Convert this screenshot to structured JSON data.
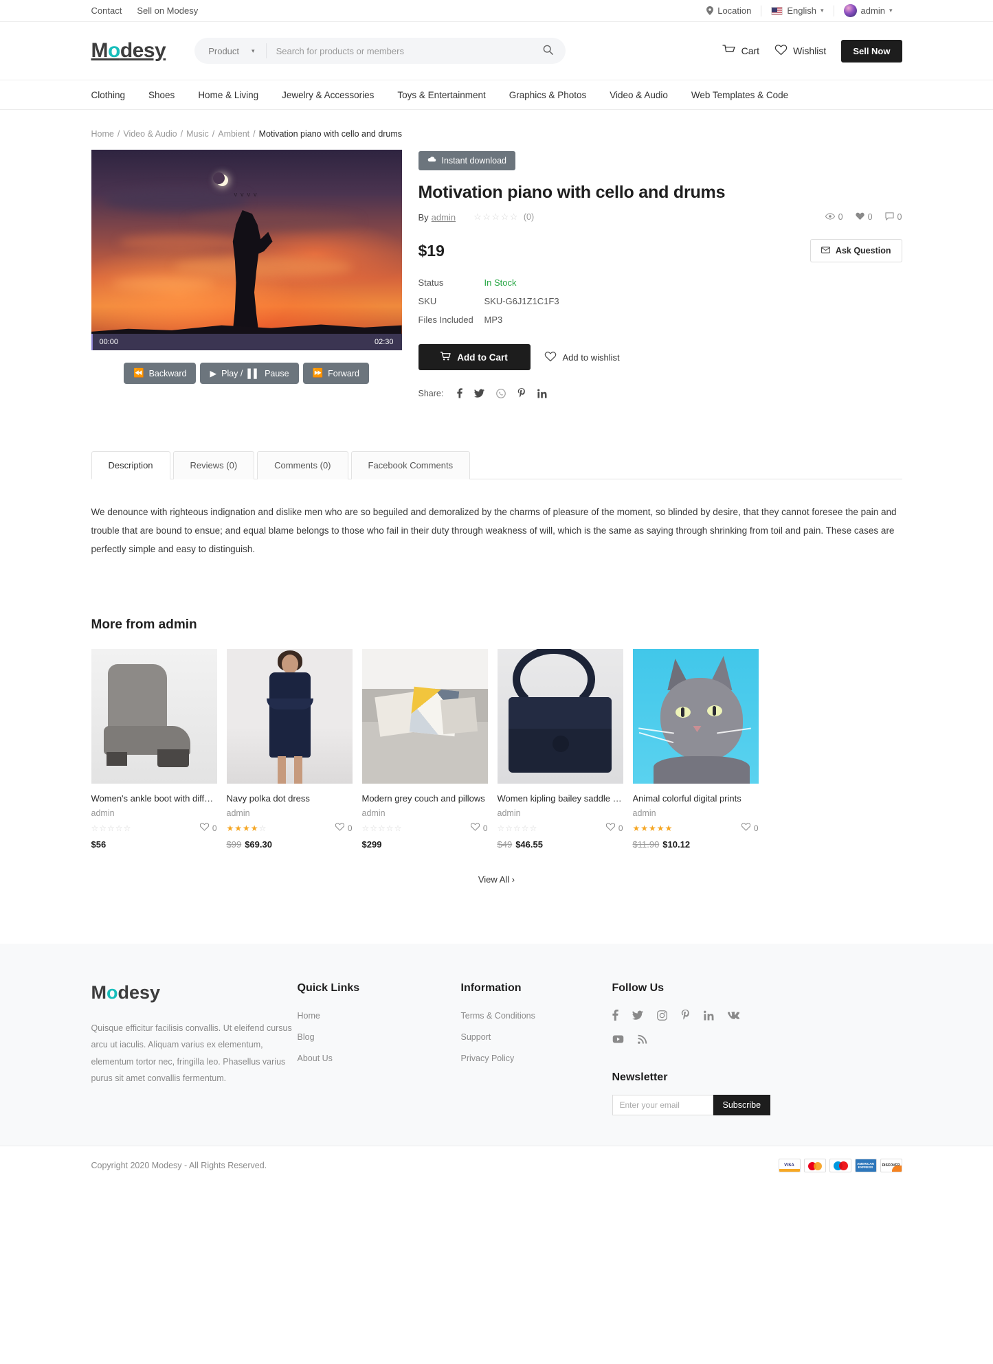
{
  "topbar": {
    "left_links": [
      "Contact",
      "Sell on Modesy"
    ],
    "location": "Location",
    "language": "English",
    "user": "admin"
  },
  "header": {
    "logo_first": "M",
    "logo_accent": "o",
    "logo_rest": "desy",
    "search_category": "Product",
    "search_placeholder": "Search for products or members",
    "cart_label": "Cart",
    "wishlist_label": "Wishlist",
    "sell_now_label": "Sell Now"
  },
  "nav": {
    "items": [
      "Clothing",
      "Shoes",
      "Home & Living",
      "Jewelry & Accessories",
      "Toys & Entertainment",
      "Graphics & Photos",
      "Video & Audio",
      "Web Templates & Code"
    ]
  },
  "breadcrumb": {
    "items": [
      "Home",
      "Video & Audio",
      "Music",
      "Ambient"
    ],
    "current": "Motivation piano with cello and drums"
  },
  "player": {
    "current_time": "00:00",
    "duration": "02:30",
    "backward_label": "Backward",
    "play_pause_label": "Play /",
    "pause_label": "Pause",
    "forward_label": "Forward"
  },
  "product": {
    "badge": "Instant download",
    "title": "Motivation piano with cello and drums",
    "by_label": "By",
    "author": "admin",
    "rating": 0,
    "rating_count": "(0)",
    "views": "0",
    "likes": "0",
    "comments": "0",
    "price": "$19",
    "ask_question_label": "Ask Question",
    "specs": [
      {
        "label": "Status",
        "value": "In Stock",
        "highlight": "#28a745"
      },
      {
        "label": "SKU",
        "value": "SKU-G6J1Z1C1F3",
        "highlight": ""
      },
      {
        "label": "Files Included",
        "value": "MP3",
        "highlight": ""
      }
    ],
    "add_to_cart_label": "Add to Cart",
    "add_to_wishlist_label": "Add to wishlist",
    "share_label": "Share:",
    "share_icons": [
      "facebook-icon",
      "twitter-icon",
      "whatsapp-icon",
      "pinterest-icon",
      "linkedin-icon"
    ]
  },
  "tabs": {
    "items": [
      "Description",
      "Reviews (0)",
      "Comments (0)",
      "Facebook Comments"
    ],
    "active_index": 0,
    "description": "We denounce with righteous indignation and dislike men who are so beguiled and demoralized by the charms of pleasure of the moment, so blinded by desire, that they cannot foresee the pain and trouble that are bound to ensue; and equal blame belongs to those who fail in their duty through weakness of will, which is the same as saying through shrinking from toil and pain. These cases are perfectly simple and easy to distinguish."
  },
  "more_from": {
    "title": "More from admin",
    "view_all": "View All",
    "products": [
      {
        "title": "Women's ankle boot with differen...",
        "author": "admin",
        "rating": 0,
        "likes": "0",
        "price": "$56",
        "old_price": "",
        "art": "art-boot"
      },
      {
        "title": "Navy polka dot dress",
        "author": "admin",
        "rating": 4,
        "likes": "0",
        "price": "$69.30",
        "old_price": "$99",
        "art": "art-dress"
      },
      {
        "title": "Modern grey couch and pillows",
        "author": "admin",
        "rating": 0,
        "likes": "0",
        "price": "$299",
        "old_price": "",
        "art": "art-couch"
      },
      {
        "title": "Women kipling bailey saddle han...",
        "author": "admin",
        "rating": 0,
        "likes": "0",
        "price": "$46.55",
        "old_price": "$49",
        "art": "art-bag"
      },
      {
        "title": "Animal colorful digital prints",
        "author": "admin",
        "rating": 5,
        "likes": "0",
        "price": "$10.12",
        "old_price": "$11.90",
        "art": "art-cat"
      }
    ]
  },
  "footer": {
    "logo_first": "M",
    "logo_accent": "o",
    "logo_rest": "desy",
    "about_text": "Quisque efficitur facilisis convallis. Ut eleifend cursus arcu ut iaculis. Aliquam varius ex elementum, elementum tortor nec, fringilla leo. Phasellus varius purus sit amet convallis fermentum.",
    "quick_links": {
      "heading": "Quick Links",
      "items": [
        "Home",
        "Blog",
        "About Us"
      ]
    },
    "information": {
      "heading": "Information",
      "items": [
        "Terms & Conditions",
        "Support",
        "Privacy Policy"
      ]
    },
    "follow": {
      "heading": "Follow Us",
      "icons": [
        "facebook-icon",
        "twitter-icon",
        "instagram-icon",
        "pinterest-icon",
        "linkedin-icon",
        "vk-icon",
        "youtube-icon",
        "rss-icon"
      ]
    },
    "newsletter": {
      "heading": "Newsletter",
      "placeholder": "Enter your email",
      "value": "",
      "button": "Subscribe"
    },
    "copyright": "Copyright 2020 Modesy - All Rights Reserved.",
    "payments": [
      "VISA",
      "MasterCard",
      "Maestro",
      "AMERICAN EXPRESS",
      "DISCOVER"
    ]
  },
  "colors": {
    "accent": "#17bebb",
    "dark": "#1d1d1d",
    "star": "#f5a623",
    "instock": "#28a745"
  }
}
